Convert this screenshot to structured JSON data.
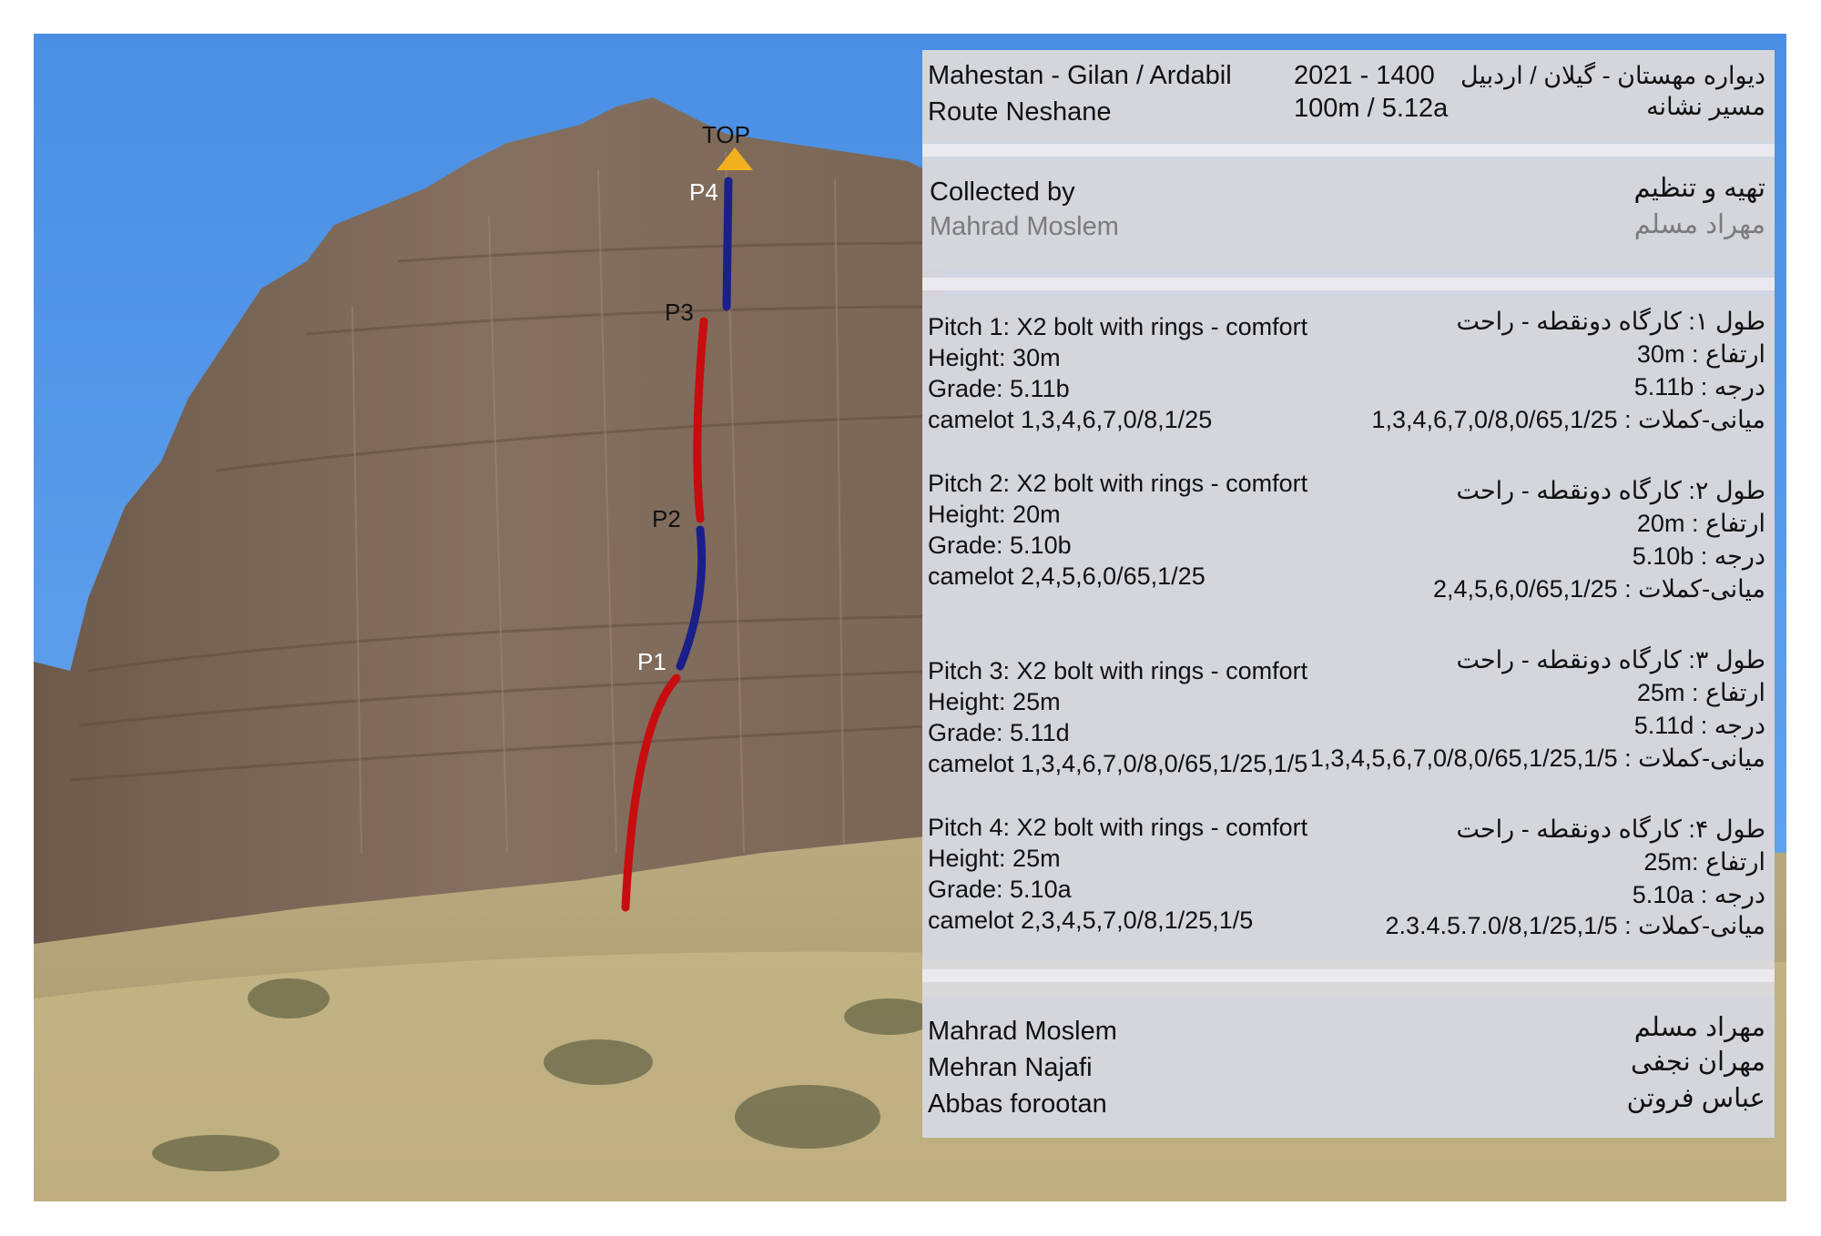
{
  "header": {
    "location_en": "Mahestan - Gilan / Ardabil",
    "route_en": "Route Neshane",
    "year": "2021 - 1400",
    "length_grade": "100m / 5.12a",
    "location_fa": "دیواره مهستان - گیلان / اردبیل",
    "route_fa": "مسیر نشانه"
  },
  "collected": {
    "label_en": "Collected by",
    "name_en": "Mahrad Moslem",
    "label_fa": "تهیه و تنظیم",
    "name_fa": "مهراد مسلم"
  },
  "pitches": [
    {
      "title_en": "Pitch 1: X2 bolt with rings - comfort",
      "height_en": "Height: 30m",
      "grade_en": "Grade: 5.11b",
      "gear_en": "camelot 1,3,4,6,7,0/8,1/25",
      "title_fa": "طول ۱: کارگاه دونقطه - راحت",
      "height_fa": "ارتفاع : 30m",
      "grade_fa": "درجه : 5.11b",
      "gear_fa": "میانی-کملات : 1,3,4,6,7,0/8,0/65,1/25"
    },
    {
      "title_en": "Pitch 2: X2 bolt with rings - comfort",
      "height_en": "Height: 20m",
      "grade_en": "Grade: 5.10b",
      "gear_en": "camelot 2,4,5,6,0/65,1/25",
      "title_fa": "طول ۲: کارگاه دونقطه - راحت",
      "height_fa": "ارتفاع : 20m",
      "grade_fa": "درجه : 5.10b",
      "gear_fa": "میانی-کملات : 2,4,5,6,0/65,1/25"
    },
    {
      "title_en": "Pitch 3: X2 bolt with rings - comfort",
      "height_en": "Height: 25m",
      "grade_en": "Grade: 5.11d",
      "gear_en": "camelot 1,3,4,6,7,0/8,0/65,1/25,1/5",
      "title_fa": "طول ۳: کارگاه دونقطه - راحت",
      "height_fa": "ارتفاع : 25m",
      "grade_fa": "درجه : 5.11d",
      "gear_fa": "میانی-کملات : 1,3,4,5,6,7,0/8,0/65,1/25,1/5"
    },
    {
      "title_en": "Pitch 4: X2 bolt with rings - comfort",
      "height_en": "Height: 25m",
      "grade_en": "Grade: 5.10a",
      "gear_en": "camelot 2,3,4,5,7,0/8,1/25,1/5",
      "title_fa": "طول ۴: کارگاه دونقطه - راحت",
      "height_fa": "ارتفاع :25m",
      "grade_fa": "درجه : 5.10a",
      "gear_fa": "میانی-کملات : 2.3.4.5.7.0/8,1/25,1/5"
    }
  ],
  "climbers": {
    "en": [
      "Mahrad Moslem",
      "Mehran Najafi",
      "Abbas forootan"
    ],
    "fa": [
      "مهراد مسلم",
      "مهران نجفی",
      "عباس فروتن"
    ]
  },
  "route_markers": {
    "top": "TOP",
    "p4": "P4",
    "p3": "P3",
    "p2": "P2",
    "p1": "P1"
  },
  "colors": {
    "sky": "#4a90e2",
    "route_red": "#c80d10",
    "route_blue": "#1a1f8a",
    "top_arrow": "#f2b01e",
    "panel": "#d5d6dc"
  }
}
